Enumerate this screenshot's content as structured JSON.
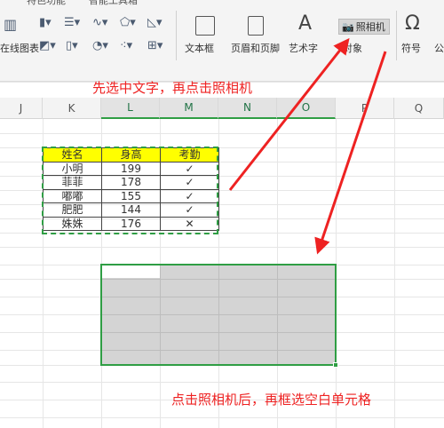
{
  "ribbon": {
    "top_tabs": [
      "特色功能",
      "智能工具箱"
    ],
    "chart_label": "在线图表",
    "textbox_label": "文本框",
    "header_footer_label": "页眉和页脚",
    "wordart_label": "艺术字",
    "camera_label": "照相机",
    "object_label": "对象",
    "symbol_label": "符号",
    "formula_label": "公"
  },
  "columns": [
    "J",
    "K",
    "L",
    "M",
    "N",
    "O",
    "P",
    "Q"
  ],
  "table": {
    "headers": [
      "姓名",
      "身高",
      "考勤"
    ],
    "rows": [
      [
        "小明",
        "199",
        "✓"
      ],
      [
        "菲菲",
        "178",
        "✓"
      ],
      [
        "嘟嘟",
        "155",
        "✓"
      ],
      [
        "肥肥",
        "144",
        "✓"
      ],
      [
        "姝姝",
        "176",
        "✕"
      ]
    ],
    "header_color": "#ffff00"
  },
  "annotations": {
    "step1": "先选中文字，再点击照相机",
    "step2": "点击照相机后，再框选空白单元格"
  },
  "colors": {
    "accent_green": "#2f9e44",
    "annotation_red": "#ee2222"
  }
}
